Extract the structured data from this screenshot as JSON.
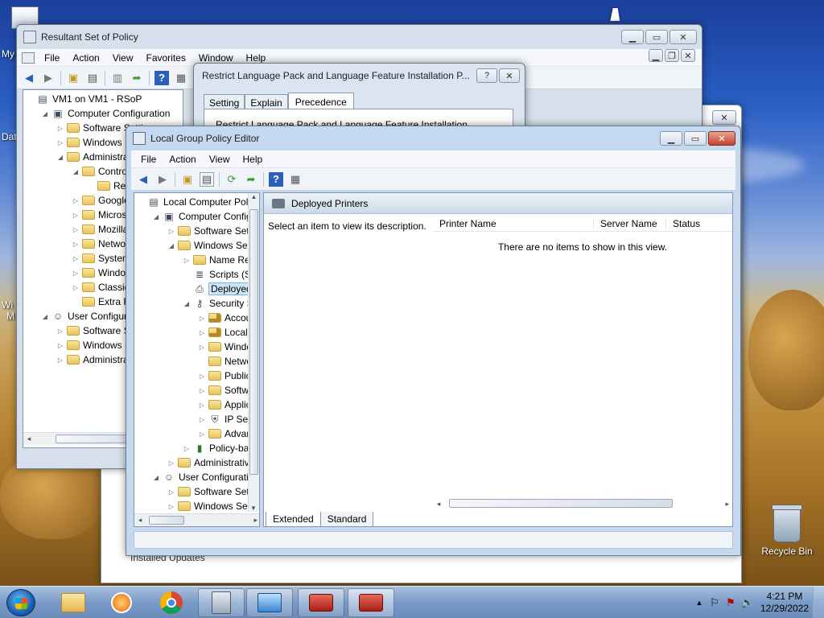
{
  "desktop": {
    "icons": [
      {
        "label": "My",
        "pos": "left-top"
      },
      {
        "label": "Dat",
        "pos": "left-mid"
      },
      {
        "label": "Wi",
        "pos": "left-low"
      },
      {
        "label": "M",
        "pos": "left-low2"
      }
    ],
    "recycle_bin": "Recycle Bin",
    "behind_window_text": "Installed Updates"
  },
  "rsop": {
    "title": "Resultant Set of Policy",
    "menu": [
      "File",
      "Action",
      "View",
      "Favorites",
      "Window",
      "Help"
    ],
    "tree": [
      {
        "label": "VM1 on VM1 - RSoP",
        "depth": 0,
        "arrow": "",
        "icon": "doc-icon"
      },
      {
        "label": "Computer Configuration",
        "depth": 1,
        "arrow": "◢",
        "icon": "computer-icon"
      },
      {
        "label": "Software Setti",
        "depth": 2,
        "arrow": "▷",
        "icon": "folder"
      },
      {
        "label": "Windows Se",
        "depth": 2,
        "arrow": "▷",
        "icon": "folder"
      },
      {
        "label": "Administrati",
        "depth": 2,
        "arrow": "◢",
        "icon": "folder"
      },
      {
        "label": "Control",
        "depth": 3,
        "arrow": "◢",
        "icon": "folder"
      },
      {
        "label": "Regi",
        "depth": 4,
        "arrow": "",
        "icon": "folder"
      },
      {
        "label": "Google",
        "depth": 3,
        "arrow": "▷",
        "icon": "folder"
      },
      {
        "label": "Microso",
        "depth": 3,
        "arrow": "▷",
        "icon": "folder"
      },
      {
        "label": "Mozilla",
        "depth": 3,
        "arrow": "▷",
        "icon": "folder"
      },
      {
        "label": "Network",
        "depth": 3,
        "arrow": "▷",
        "icon": "folder"
      },
      {
        "label": "System",
        "depth": 3,
        "arrow": "▷",
        "icon": "folder"
      },
      {
        "label": "Window",
        "depth": 3,
        "arrow": "▷",
        "icon": "folder"
      },
      {
        "label": "Classic A",
        "depth": 3,
        "arrow": "▷",
        "icon": "folder"
      },
      {
        "label": "Extra Reg",
        "depth": 3,
        "arrow": "",
        "icon": "folder"
      },
      {
        "label": "User Configurat",
        "depth": 1,
        "arrow": "◢",
        "icon": "user-icon"
      },
      {
        "label": "Software Set",
        "depth": 2,
        "arrow": "▷",
        "icon": "folder"
      },
      {
        "label": "Windows Se",
        "depth": 2,
        "arrow": "▷",
        "icon": "folder"
      },
      {
        "label": "Administrati",
        "depth": 2,
        "arrow": "▷",
        "icon": "folder"
      }
    ]
  },
  "dialog": {
    "title": "Restrict Language Pack and Language Feature Installation P...",
    "help_btn": "?",
    "tabs": [
      "Setting",
      "Explain",
      "Precedence"
    ],
    "active_tab": "Precedence",
    "body_text": "Restrict Language Pack and Language Feature Installation"
  },
  "gpedit": {
    "title": "Local Group Policy Editor",
    "menu": [
      "File",
      "Action",
      "View",
      "Help"
    ],
    "tree": [
      {
        "label": "Local Computer Polic",
        "depth": 0,
        "arrow": "",
        "icon": "doc-icon"
      },
      {
        "label": "Computer Config",
        "depth": 1,
        "arrow": "◢",
        "icon": "computer-icon"
      },
      {
        "label": "Software Setti",
        "depth": 2,
        "arrow": "▷",
        "icon": "folder"
      },
      {
        "label": "Windows Sett",
        "depth": 2,
        "arrow": "◢",
        "icon": "folder"
      },
      {
        "label": "Name Res",
        "depth": 3,
        "arrow": "▷",
        "icon": "folder"
      },
      {
        "label": "Scripts (Sta",
        "depth": 3,
        "arrow": "",
        "icon": "script-icon"
      },
      {
        "label": "Deployed",
        "depth": 3,
        "arrow": "",
        "icon": "printer-icon",
        "selected": true
      },
      {
        "label": "Security Se",
        "depth": 3,
        "arrow": "◢",
        "icon": "security-icon"
      },
      {
        "label": "Accou",
        "depth": 4,
        "arrow": "▷",
        "icon": "folder-lock"
      },
      {
        "label": "Local P",
        "depth": 4,
        "arrow": "▷",
        "icon": "folder-lock"
      },
      {
        "label": "Windo",
        "depth": 4,
        "arrow": "▷",
        "icon": "folder"
      },
      {
        "label": "Netwo",
        "depth": 4,
        "arrow": "",
        "icon": "folder"
      },
      {
        "label": "Public",
        "depth": 4,
        "arrow": "▷",
        "icon": "folder"
      },
      {
        "label": "Softwa",
        "depth": 4,
        "arrow": "▷",
        "icon": "folder"
      },
      {
        "label": "Applic",
        "depth": 4,
        "arrow": "▷",
        "icon": "folder"
      },
      {
        "label": "IP Secu",
        "depth": 4,
        "arrow": "▷",
        "icon": "ipsec-icon"
      },
      {
        "label": "Advan",
        "depth": 4,
        "arrow": "▷",
        "icon": "folder"
      },
      {
        "label": "Policy-bas",
        "depth": 3,
        "arrow": "▷",
        "icon": "chart-icon"
      },
      {
        "label": "Administrative",
        "depth": 2,
        "arrow": "▷",
        "icon": "folder"
      },
      {
        "label": "User Configuratio",
        "depth": 1,
        "arrow": "◢",
        "icon": "user-icon"
      },
      {
        "label": "Software Setti",
        "depth": 2,
        "arrow": "▷",
        "icon": "folder"
      },
      {
        "label": "Windows Sett",
        "depth": 2,
        "arrow": "▷",
        "icon": "folder"
      }
    ],
    "pane_header": "Deployed Printers",
    "description": "Select an item to view its description.",
    "columns": [
      "Printer Name",
      "Server Name",
      "Status"
    ],
    "empty_text": "There are no items to show in this view.",
    "bottom_tabs": [
      "Extended",
      "Standard"
    ]
  },
  "taskbar": {
    "time": "4:21 PM",
    "date": "12/29/2022",
    "apps": [
      "explorer",
      "media-player",
      "chrome",
      "server-manager",
      "remote-desktop",
      "toolbox-1",
      "toolbox-2"
    ]
  }
}
